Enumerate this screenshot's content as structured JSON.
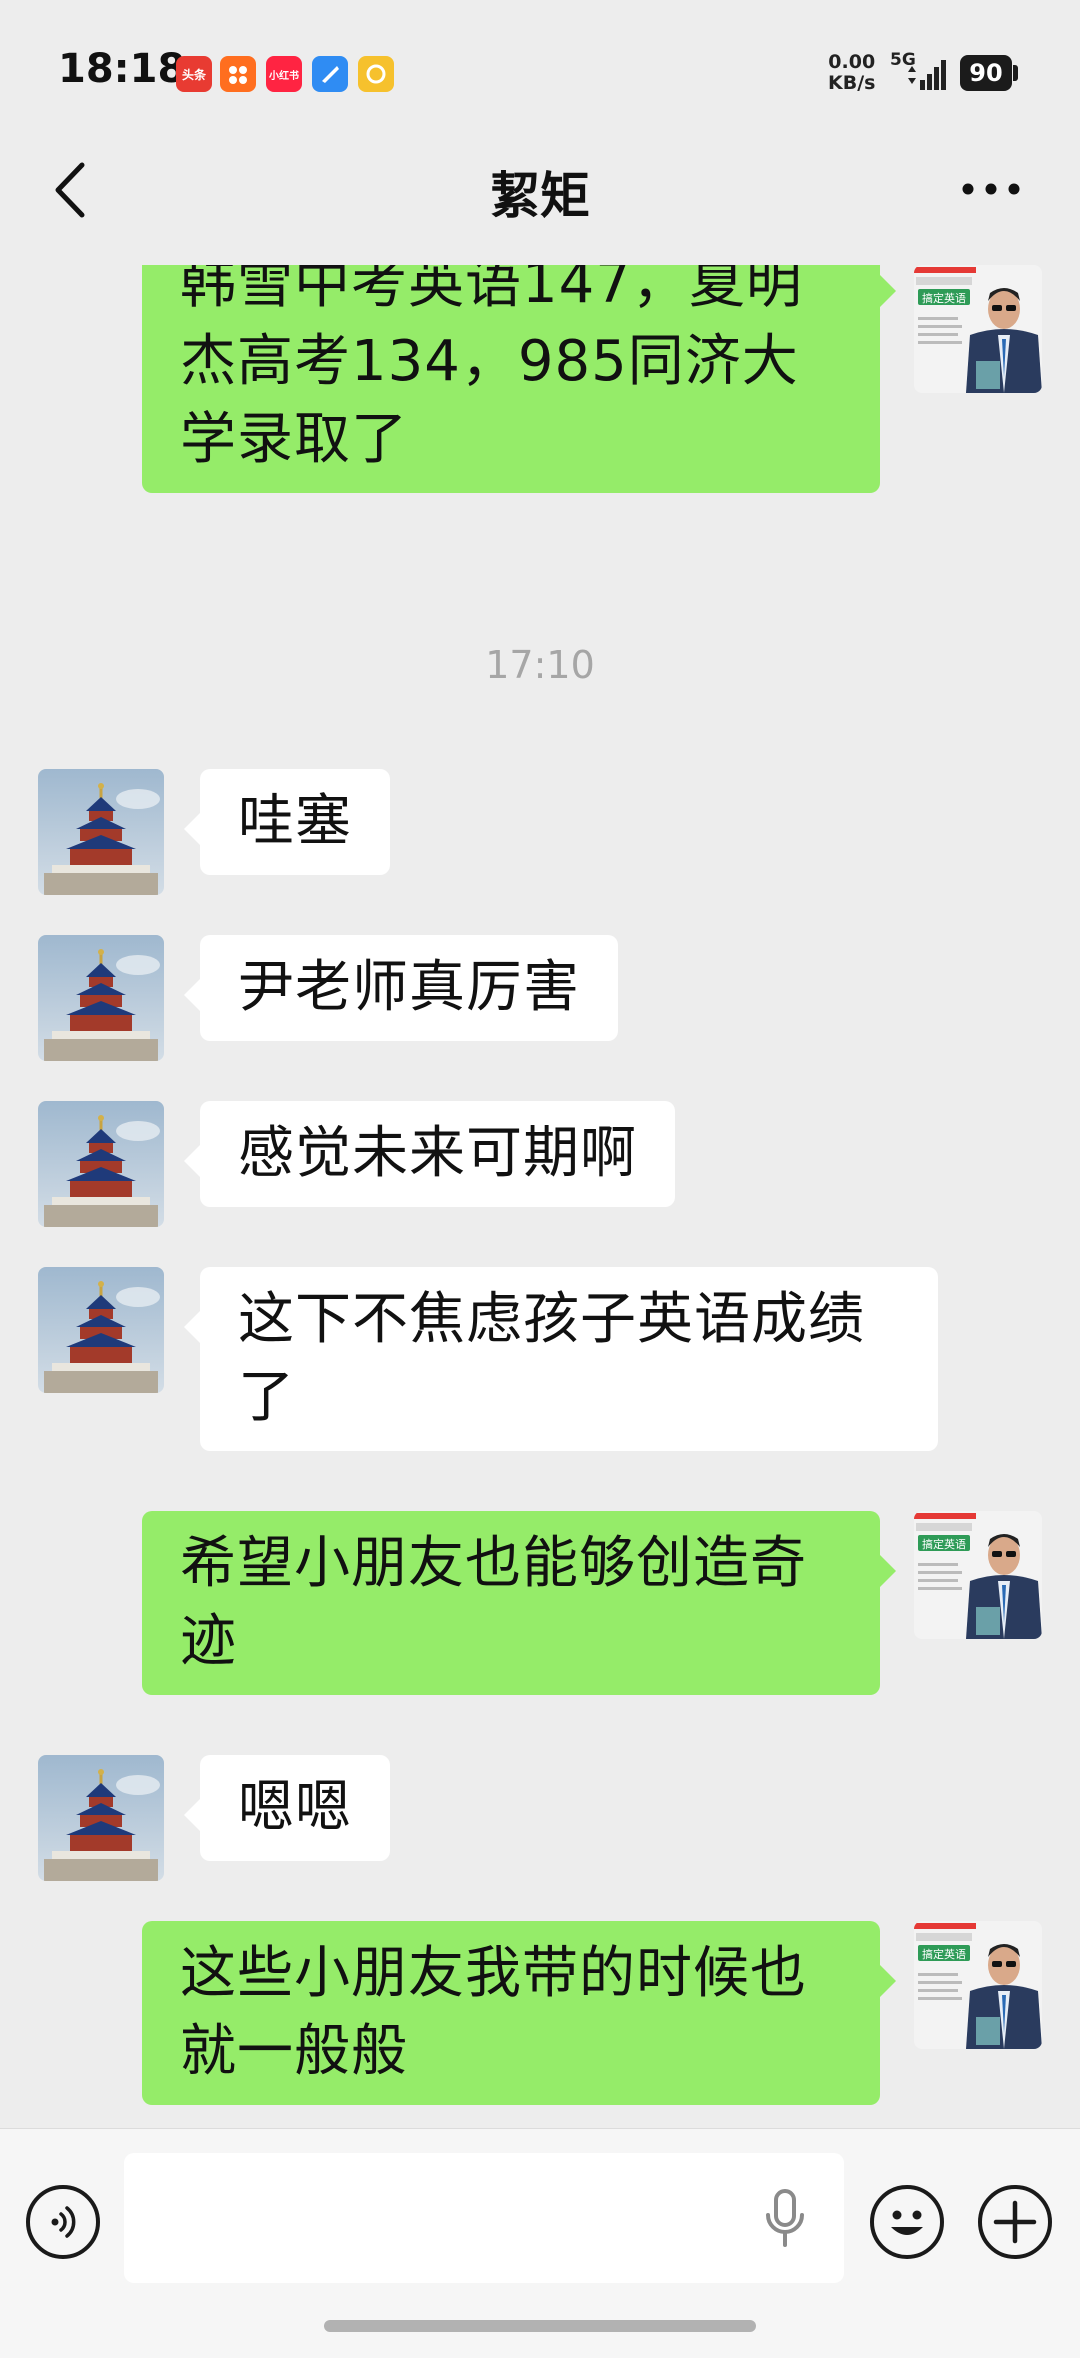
{
  "status_bar": {
    "time": "18:18",
    "notifications": [
      {
        "label": "头条",
        "color": "#e83b32"
      },
      {
        "label": "",
        "color": "#ff6e1f"
      },
      {
        "label": "小红书",
        "color": "#ff2442"
      },
      {
        "label": "",
        "color": "#2f8cf3"
      },
      {
        "label": "",
        "color": "#f6c12d"
      }
    ],
    "net_speed_value": "0.00",
    "net_speed_unit": "KB/s",
    "network": "5G",
    "battery": "90"
  },
  "header": {
    "title": "絜矩"
  },
  "chat": {
    "messages": [
      {
        "side": "out",
        "text": "韩雪中考英语147，夏明杰高考134，985同济大学录取了"
      },
      {
        "side": "in",
        "text": "哇塞"
      },
      {
        "side": "in",
        "text": "尹老师真厉害"
      },
      {
        "side": "in",
        "text": "感觉未来可期啊"
      },
      {
        "side": "in",
        "text": "这下不焦虑孩子英语成绩了"
      },
      {
        "side": "out",
        "text": "希望小朋友也能够创造奇迹"
      },
      {
        "side": "in",
        "text": "嗯嗯"
      },
      {
        "side": "out",
        "text": "这些小朋友我带的时候也就一般般"
      }
    ],
    "timestamp": "17:10",
    "self_avatar": {
      "banner": "搞定英语"
    }
  },
  "input_bar": {
    "placeholder": ""
  },
  "colors": {
    "background": "#ededed",
    "outgoing_bubble": "#95ec69",
    "incoming_bubble": "#ffffff"
  }
}
